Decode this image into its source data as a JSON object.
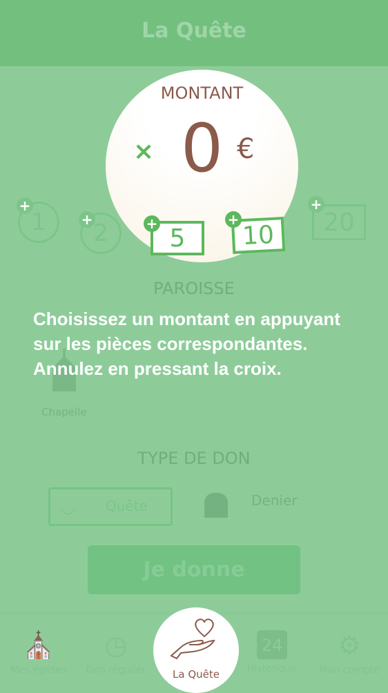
{
  "header": {
    "title": "La Quête"
  },
  "amount": {
    "label": "MONTANT",
    "value": "0",
    "currency": "€",
    "cancel_icon": "×"
  },
  "denominations": [
    {
      "value": "1",
      "type": "coin"
    },
    {
      "value": "2",
      "type": "coin"
    },
    {
      "value": "5",
      "type": "note"
    },
    {
      "value": "10",
      "type": "note"
    },
    {
      "value": "20",
      "type": "note"
    }
  ],
  "paroisse": {
    "label": "PAROISSE",
    "church_name": "Chapelle"
  },
  "hint": {
    "text": "Choisissez un montant en appuyant sur les pièces correspondantes. Annulez en pressant la croix."
  },
  "type_don": {
    "label": "TYPE DE DON",
    "options": [
      {
        "label": "Quête",
        "selected": true
      },
      {
        "label": "Denier",
        "selected": false
      }
    ]
  },
  "submit": {
    "label": "Je donne"
  },
  "tabs": [
    {
      "label": "Mes églises"
    },
    {
      "label": "Don régulier"
    },
    {
      "label": "La Quête",
      "active": true
    },
    {
      "label": "Historique",
      "day": "24"
    },
    {
      "label": "Mon compte"
    }
  ],
  "colors": {
    "green": "#5cb85c",
    "brown": "#8a5a4a",
    "overlay": "#8dcc99"
  }
}
